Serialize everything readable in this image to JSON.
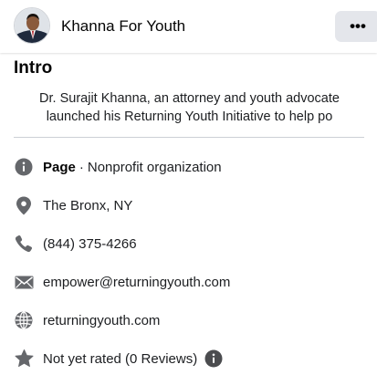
{
  "header": {
    "page_name": "Khanna For Youth",
    "more_label": "•••"
  },
  "intro": {
    "title": "Intro",
    "bio_line1": "Dr. Surajit Khanna, an attorney and youth advocate",
    "bio_line2": "launched his Returning Youth Initiative to help po"
  },
  "details": {
    "page_label": "Page",
    "separator": "·",
    "category": "Nonprofit organization",
    "location": "The Bronx, NY",
    "phone": "(844) 375-4266",
    "email": "empower@returningyouth.com",
    "website": "returningyouth.com",
    "rating": "Not yet rated (0 Reviews)"
  },
  "icons": {
    "category": "info-circle-icon",
    "location": "map-pin-icon",
    "phone": "phone-icon",
    "email": "envelope-icon",
    "website": "globe-icon",
    "rating": "star-icon",
    "rating_info": "info-circle-icon"
  },
  "colors": {
    "icon_gray": "#65676b",
    "link_blue": "#216fdb",
    "button_bg": "#e4e6eb",
    "divider": "#ccd0d5"
  }
}
